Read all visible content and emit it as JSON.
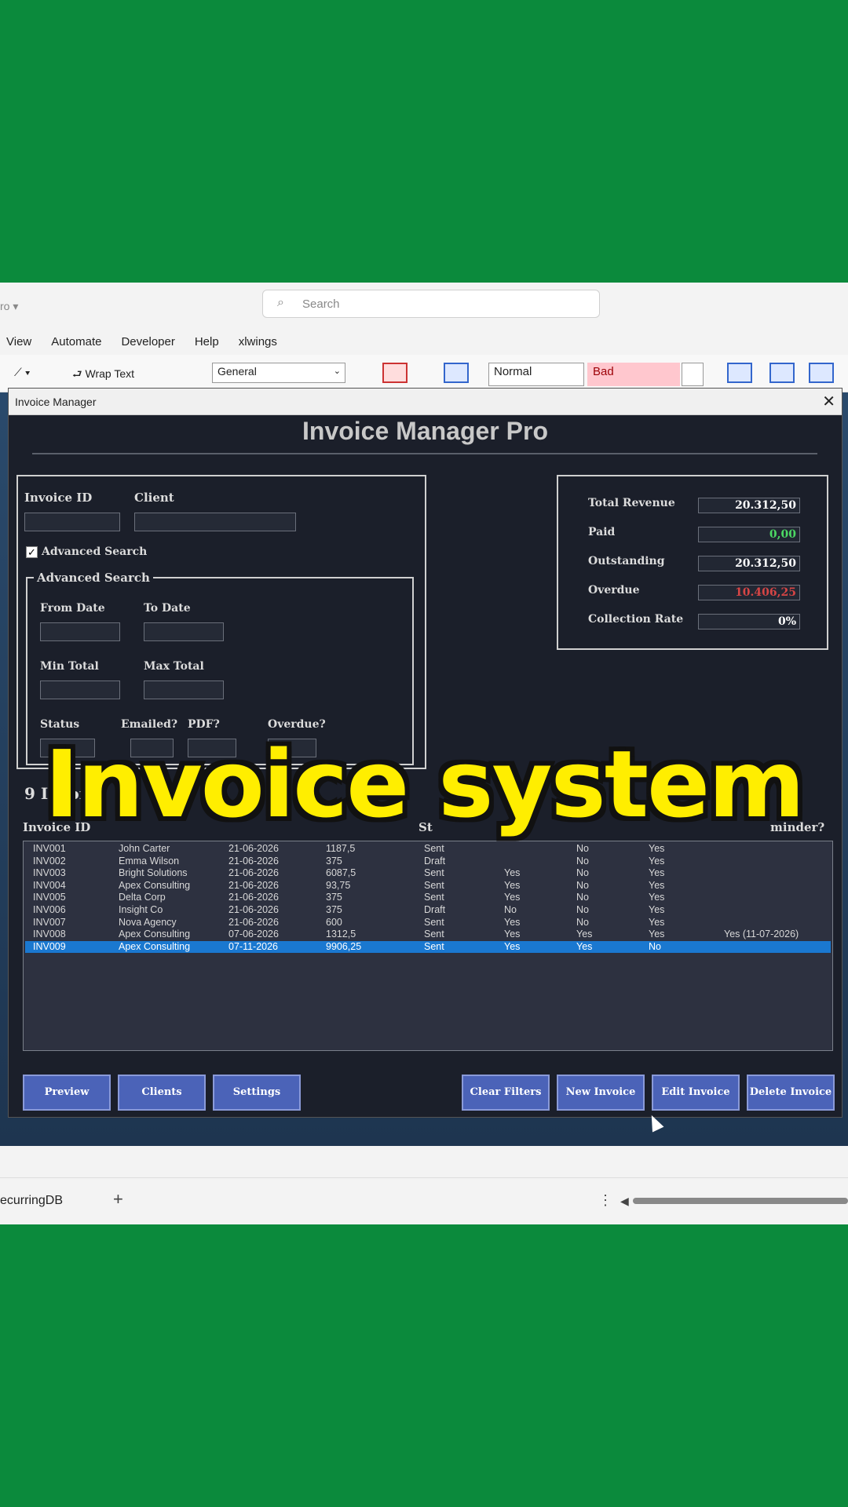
{
  "excel": {
    "app_fragment": "ro ▾",
    "search_placeholder": "Search",
    "menu": [
      "View",
      "Automate",
      "Developer",
      "Help",
      "xlwings"
    ],
    "ribbon": {
      "wrap_text": "Wrap Text",
      "number_format": "General",
      "style_normal": "Normal",
      "style_bad": "Bad"
    },
    "sheet_tab": "ecurringDB",
    "add_sheet": "+"
  },
  "window": {
    "title": "Invoice Manager",
    "close": "✕",
    "app_title": "Invoice Manager Pro"
  },
  "search": {
    "invoice_id_label": "Invoice ID",
    "client_label": "Client",
    "advanced_checkbox_label": "Advanced Search",
    "advanced_checked": true,
    "advanced_frame_label": "Advanced Search",
    "from_date_label": "From Date",
    "to_date_label": "To Date",
    "min_total_label": "Min Total",
    "max_total_label": "Max Total",
    "status_label": "Status",
    "emailed_label": "Emailed?",
    "pdf_label": "PDF?",
    "overdue_label": "Overdue?"
  },
  "stats": [
    {
      "label": "Total Revenue",
      "value": "20.312,50",
      "color": "#ffffff"
    },
    {
      "label": "Paid",
      "value": "0,00",
      "color": "#4cd964"
    },
    {
      "label": "Outstanding",
      "value": "20.312,50",
      "color": "#ffffff"
    },
    {
      "label": "Overdue",
      "value": "10.406,25",
      "color": "#d64545"
    },
    {
      "label": "Collection Rate",
      "value": "0%",
      "color": "#ffffff"
    }
  ],
  "list": {
    "count_label": "9 Invoic",
    "col_invoice_id": "Invoice ID",
    "col_status_fragment": "St",
    "col_reminder_fragment": "minder?",
    "rows": [
      {
        "id": "INV001",
        "client": "John Carter",
        "date": "21-06-2026",
        "total": "1187,5",
        "status": "Sent",
        "emailed": "",
        "pdf": "No",
        "overdue": "Yes",
        "reminder": ""
      },
      {
        "id": "INV002",
        "client": "Emma Wilson",
        "date": "21-06-2026",
        "total": "375",
        "status": "Draft",
        "emailed": "",
        "pdf": "No",
        "overdue": "Yes",
        "reminder": ""
      },
      {
        "id": "INV003",
        "client": "Bright Solutions",
        "date": "21-06-2026",
        "total": "6087,5",
        "status": "Sent",
        "emailed": "Yes",
        "pdf": "No",
        "overdue": "Yes",
        "reminder": ""
      },
      {
        "id": "INV004",
        "client": "Apex Consulting",
        "date": "21-06-2026",
        "total": "93,75",
        "status": "Sent",
        "emailed": "Yes",
        "pdf": "No",
        "overdue": "Yes",
        "reminder": ""
      },
      {
        "id": "INV005",
        "client": "Delta Corp",
        "date": "21-06-2026",
        "total": "375",
        "status": "Sent",
        "emailed": "Yes",
        "pdf": "No",
        "overdue": "Yes",
        "reminder": ""
      },
      {
        "id": "INV006",
        "client": "Insight Co",
        "date": "21-06-2026",
        "total": "375",
        "status": "Draft",
        "emailed": "No",
        "pdf": "No",
        "overdue": "Yes",
        "reminder": ""
      },
      {
        "id": "INV007",
        "client": "Nova Agency",
        "date": "21-06-2026",
        "total": "600",
        "status": "Sent",
        "emailed": "Yes",
        "pdf": "No",
        "overdue": "Yes",
        "reminder": ""
      },
      {
        "id": "INV008",
        "client": "Apex Consulting",
        "date": "07-06-2026",
        "total": "1312,5",
        "status": "Sent",
        "emailed": "Yes",
        "pdf": "Yes",
        "overdue": "Yes",
        "reminder": "Yes (11-07-2026)"
      },
      {
        "id": "INV009",
        "client": "Apex Consulting",
        "date": "07-11-2026",
        "total": "9906,25",
        "status": "Sent",
        "emailed": "Yes",
        "pdf": "Yes",
        "overdue": "No",
        "reminder": ""
      }
    ],
    "selected_index": 8
  },
  "buttons": {
    "preview": "Preview",
    "clients": "Clients",
    "settings": "Settings",
    "clear_filters": "Clear Filters",
    "new_invoice": "New Invoice",
    "edit_invoice": "Edit Invoice",
    "delete_invoice": "Delete Invoice"
  },
  "overlay_caption": "Invoice system"
}
